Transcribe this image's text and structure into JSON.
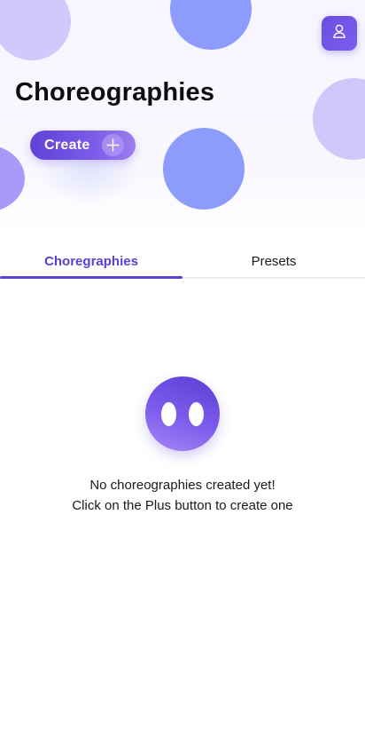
{
  "header": {
    "title": "Choreographies",
    "create_label": "Create",
    "profile_icon": "user-icon",
    "create_icon": "plus-icon"
  },
  "tabs": [
    {
      "label": "Choregraphies",
      "active": true
    },
    {
      "label": "Presets",
      "active": false
    }
  ],
  "empty_state": {
    "icon": "ghost-face-icon",
    "line1": "No choreographies created yet!",
    "line2": "Click on the Plus button to create one"
  },
  "colors": {
    "accent": "#5b3fd6",
    "bubble_blue": "#8d9cfc",
    "bubble_lavender": "#d2c8fb"
  }
}
